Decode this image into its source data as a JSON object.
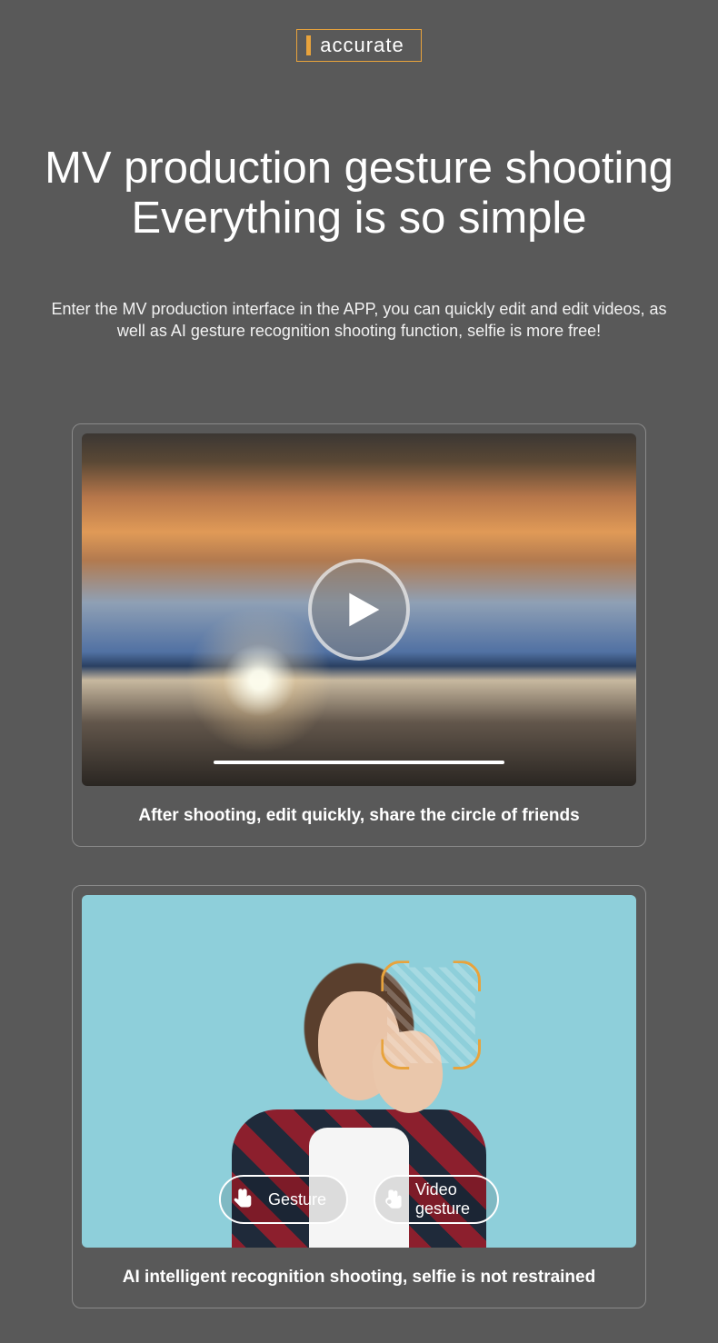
{
  "badge": {
    "label": "accurate"
  },
  "title_line1": "MV production gesture shooting",
  "title_line2": "Everything is so simple",
  "subtitle": "Enter the MV production interface in the APP, you can quickly edit and edit videos, as well as AI gesture recognition shooting function, selfie is more free!",
  "card1": {
    "caption": "After shooting, edit quickly, share the circle of friends",
    "icon": "play-icon"
  },
  "card2": {
    "caption": "AI intelligent recognition shooting, selfie is not restrained",
    "pill1": {
      "label": "Gesture",
      "icon": "hand-point-icon"
    },
    "pill2": {
      "label": "Video gesture",
      "icon": "hand-ok-icon"
    }
  },
  "colors": {
    "accent": "#e8a33c",
    "bg": "#595959"
  }
}
